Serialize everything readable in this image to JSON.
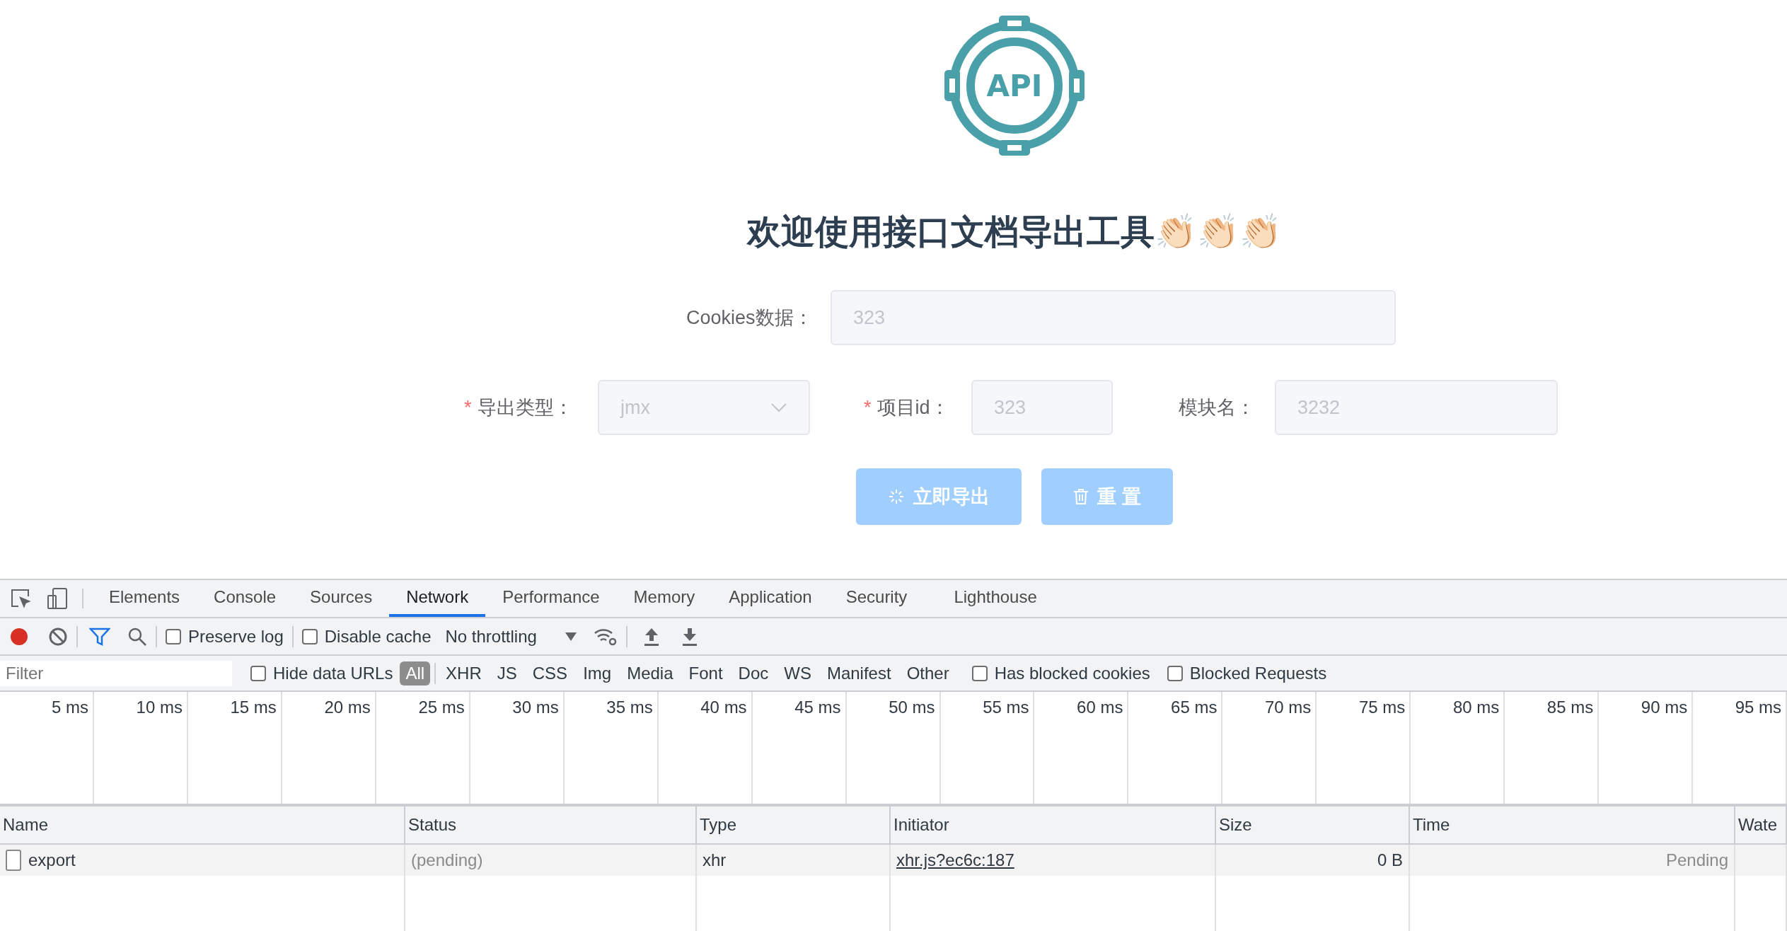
{
  "logo": {
    "text": "API"
  },
  "title": "欢迎使用接口文档导出工具👏🏻👏🏻👏🏻",
  "form": {
    "rows": [
      {
        "fields": [
          {
            "kind": "input",
            "label": "Cookies数据：",
            "value": "323",
            "disabled": true
          }
        ]
      },
      {
        "fields": [
          {
            "kind": "select",
            "required_mark": "*",
            "label": "导出类型：",
            "value": "jmx",
            "disabled": true
          },
          {
            "kind": "input",
            "required_mark": "*",
            "label": "项目id：",
            "value": "323",
            "disabled": true
          },
          {
            "kind": "input",
            "label": "模块名：",
            "value": "3232",
            "disabled": true
          }
        ]
      }
    ],
    "buttons": [
      {
        "label": "立即导出",
        "disabled": true
      },
      {
        "label": "重 置",
        "disabled": true
      }
    ]
  },
  "devtools": {
    "tabs": [
      {
        "label": "Elements",
        "selected": false
      },
      {
        "label": "Console",
        "selected": false
      },
      {
        "label": "Sources",
        "selected": false
      },
      {
        "label": "Network",
        "selected": true
      },
      {
        "label": "Performance",
        "selected": false
      },
      {
        "label": "Memory",
        "selected": false
      },
      {
        "label": "Application",
        "selected": false
      },
      {
        "label": "Security",
        "selected": false
      },
      {
        "label": "Lighthouse",
        "selected": false
      }
    ],
    "toolbar": {
      "recording": true,
      "filter_active": true,
      "preserve_log": {
        "label": "Preserve log",
        "checked": false
      },
      "disable_cache": {
        "label": "Disable cache",
        "checked": false
      },
      "throttling": "No throttling"
    },
    "filter_bar": {
      "placeholder": "Filter",
      "hide_data_urls": {
        "label": "Hide data URLs",
        "checked": false
      },
      "types": [
        {
          "label": "All",
          "selected": true
        },
        {
          "label": "XHR",
          "selected": false
        },
        {
          "label": "JS",
          "selected": false
        },
        {
          "label": "CSS",
          "selected": false
        },
        {
          "label": "Img",
          "selected": false
        },
        {
          "label": "Media",
          "selected": false
        },
        {
          "label": "Font",
          "selected": false
        },
        {
          "label": "Doc",
          "selected": false
        },
        {
          "label": "WS",
          "selected": false
        },
        {
          "label": "Manifest",
          "selected": false
        },
        {
          "label": "Other",
          "selected": false
        }
      ],
      "has_blocked_cookies": {
        "label": "Has blocked cookies",
        "checked": false
      },
      "blocked_requests": {
        "label": "Blocked Requests",
        "checked": false
      }
    },
    "timeline": {
      "ticks": [
        "5 ms",
        "10 ms",
        "15 ms",
        "20 ms",
        "25 ms",
        "30 ms",
        "35 ms",
        "40 ms",
        "45 ms",
        "50 ms",
        "55 ms",
        "60 ms",
        "65 ms",
        "70 ms",
        "75 ms",
        "80 ms",
        "85 ms",
        "90 ms",
        "95 ms"
      ]
    },
    "table": {
      "columns": [
        "Name",
        "Status",
        "Type",
        "Initiator",
        "Size",
        "Time",
        "Wate"
      ],
      "rows": [
        {
          "name": "export",
          "status": "(pending)",
          "type": "xhr",
          "initiator": "xhr.js?ec6c:187",
          "size": "0 B",
          "time": "Pending"
        }
      ]
    }
  }
}
